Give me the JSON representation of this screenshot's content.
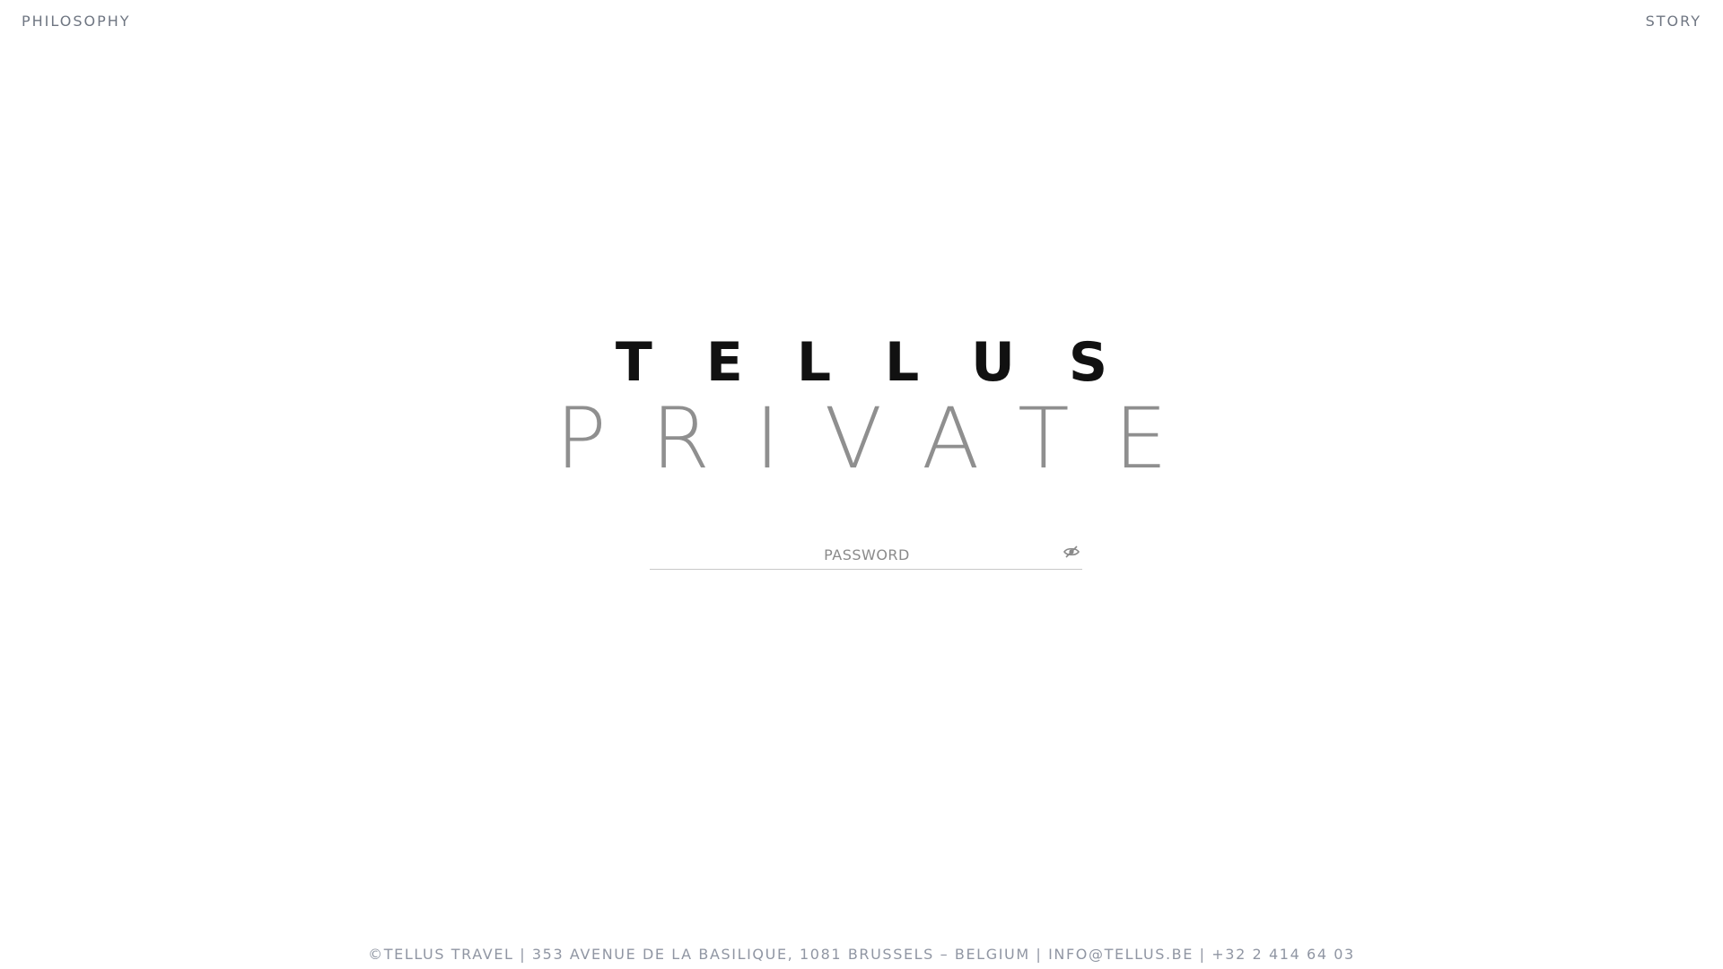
{
  "nav": {
    "left_label": "PHILOSOPHY",
    "right_label": "STORY"
  },
  "brand": {
    "line1": "TELLUS",
    "line2": "PRIVATE"
  },
  "password": {
    "placeholder": "PASSWORD",
    "value": "",
    "toggle_icon": "eye-slash-icon"
  },
  "footer": {
    "text": "©TELLUS TRAVEL | 353 AVENUE DE LA BASILIQUE, 1081 BRUSSELS – BELGIUM | INFO@TELLUS.BE | +32 2 414 64 03"
  },
  "colors": {
    "nav": "#6f7682",
    "brand_primary": "#111111",
    "brand_secondary": "#8f8f8f",
    "footer": "#9096a3"
  }
}
